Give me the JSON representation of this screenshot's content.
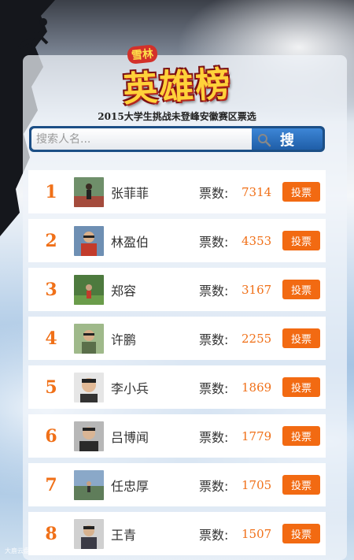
{
  "header": {
    "logo_tag": "雪林",
    "logo_title": "英雄榜",
    "subtitle": "2015大学生挑战未登峰安徽赛区票选"
  },
  "search": {
    "placeholder": "搜索人名...",
    "button_label": "搜"
  },
  "votes_label": "票数:",
  "vote_button_label": "投票",
  "candidates": [
    {
      "rank": "1",
      "name": "张菲菲",
      "votes": "7314"
    },
    {
      "rank": "2",
      "name": "林盈伯",
      "votes": "4353"
    },
    {
      "rank": "3",
      "name": "郑容",
      "votes": "3167"
    },
    {
      "rank": "4",
      "name": "许鹏",
      "votes": "2255"
    },
    {
      "rank": "5",
      "name": "李小兵",
      "votes": "1869"
    },
    {
      "rank": "6",
      "name": "吕博闻",
      "votes": "1779"
    },
    {
      "rank": "7",
      "name": "任忠厚",
      "votes": "1705"
    },
    {
      "rank": "8",
      "name": "王青",
      "votes": "1507"
    }
  ],
  "watermark": "大鹿云盘",
  "colors": {
    "accent": "#f07018",
    "button": "#f26a12",
    "search_bar": "#1c4f86"
  }
}
